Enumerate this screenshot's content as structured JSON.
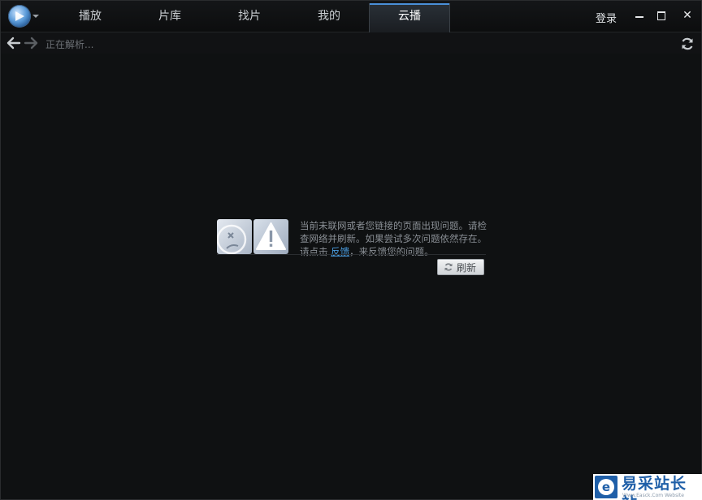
{
  "tabs": [
    {
      "label": "播放"
    },
    {
      "label": "片库"
    },
    {
      "label": "找片"
    },
    {
      "label": "我的"
    },
    {
      "label": "云播"
    }
  ],
  "active_tab": "云播",
  "header": {
    "login_label": "登录",
    "minimize_icon": "minimize-icon",
    "maximize_icon": "maximize-icon",
    "close_icon": "close-icon",
    "close_glyph": "✕"
  },
  "navbar": {
    "status_text": "正在解析...",
    "back_icon": "arrow-left-icon",
    "forward_icon": "arrow-right-icon",
    "refresh_icon": "refresh-icon"
  },
  "error": {
    "message_part1": "当前未联网或者您链接的页面出现问题。请检查网络并刷新。如果尝试多次问题依然存在。请点击 ",
    "link_label": "反馈",
    "message_part2": "，来反馈您的问题。",
    "refresh_button_label": "刷新"
  },
  "watermark": {
    "logo_letter": "e",
    "text": "易采站长站",
    "sub": "Www.Easck.Com  Website"
  },
  "colors": {
    "accent": "#4a8fd8",
    "link": "#4a9de0",
    "background": "#0f1112"
  }
}
